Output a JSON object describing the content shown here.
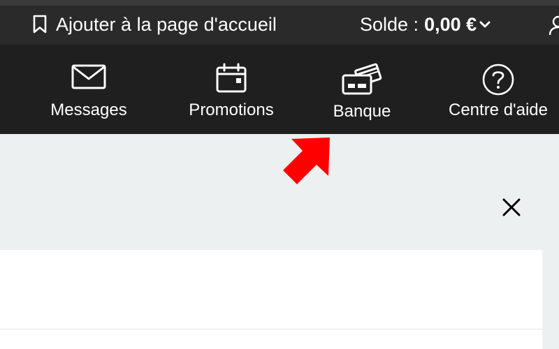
{
  "top_bar": {
    "bookmark_label": "Ajouter à la page d'accueil",
    "bookmark_icon": "bookmark-icon",
    "balance_label": "Solde :",
    "balance_value": "0,00 €",
    "balance_chevron_icon": "chevron-down-icon",
    "user_icon": "user-icon"
  },
  "nav": {
    "items": [
      {
        "label": "Messages",
        "icon": "envelope-icon"
      },
      {
        "label": "Promotions",
        "icon": "calendar-icon"
      },
      {
        "label": "Banque",
        "icon": "credit-cards-icon"
      },
      {
        "label": "Centre d'aide",
        "icon": "help-circle-icon"
      }
    ]
  },
  "colors": {
    "top_bar_bg": "#2a2a2a",
    "nav_bg": "#1f1f1f",
    "page_bg": "#edf0f1",
    "arrow": "#ff0000",
    "text": "#ffffff"
  },
  "content": {
    "close_icon": "close-icon",
    "pointer_icon": "red-arrow-pointer-icon"
  }
}
